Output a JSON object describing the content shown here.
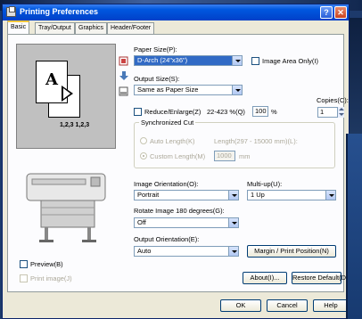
{
  "window": {
    "title": "Printing Preferences",
    "help_btn": "?",
    "close_btn": "✕"
  },
  "tabs": [
    "Basic",
    "Tray/Output",
    "Graphics",
    "Header/Footer"
  ],
  "preview": {
    "letter_front": "A",
    "letter_back": "A",
    "collate_text": "1,2,3 1,2,3"
  },
  "paper_size": {
    "label": "Paper Size(P):",
    "value": "D-Arch (24\"x36\")"
  },
  "image_area_only": {
    "label": "Image Area Only(I)",
    "checked": false
  },
  "output_size": {
    "label": "Output Size(S):",
    "value": "Same as Paper Size"
  },
  "copies": {
    "label": "Copies(C):",
    "value": "1"
  },
  "reduce_enlarge": {
    "label": "Reduce/Enlarge(Z)",
    "ratio_text": "22-423 %(Q)",
    "value": "100",
    "unit": "%"
  },
  "synchronized_cut": {
    "label": "Synchronized Cut",
    "auto_length": "Auto Length(K)",
    "length_range": "Length(297 - 15000 mm)(L):",
    "custom_length": "Custom Length(M)",
    "custom_value": "1000",
    "custom_unit": "mm"
  },
  "image_orientation": {
    "label": "Image Orientation(O):",
    "value": "Portrait"
  },
  "multi_up": {
    "label": "Multi-up(U):",
    "value": "1 Up"
  },
  "rotate": {
    "label": "Rotate Image 180 degrees(G):",
    "value": "Off"
  },
  "output_orientation": {
    "label": "Output Orientation(E):",
    "value": "Auto"
  },
  "margin_button": "Margin / Print Position(N)",
  "preview_check": {
    "label": "Preview(B)"
  },
  "print_image_check": {
    "label": "Print image(J)"
  },
  "about_button": "About(I)...",
  "restore_button": "Restore Default(D)",
  "ok_button": "OK",
  "cancel_button": "Cancel",
  "help_button": "Help",
  "colors": {
    "titlebar": "#0054e3",
    "dialog_bg": "#ece9d8",
    "selection": "#316ac5"
  }
}
